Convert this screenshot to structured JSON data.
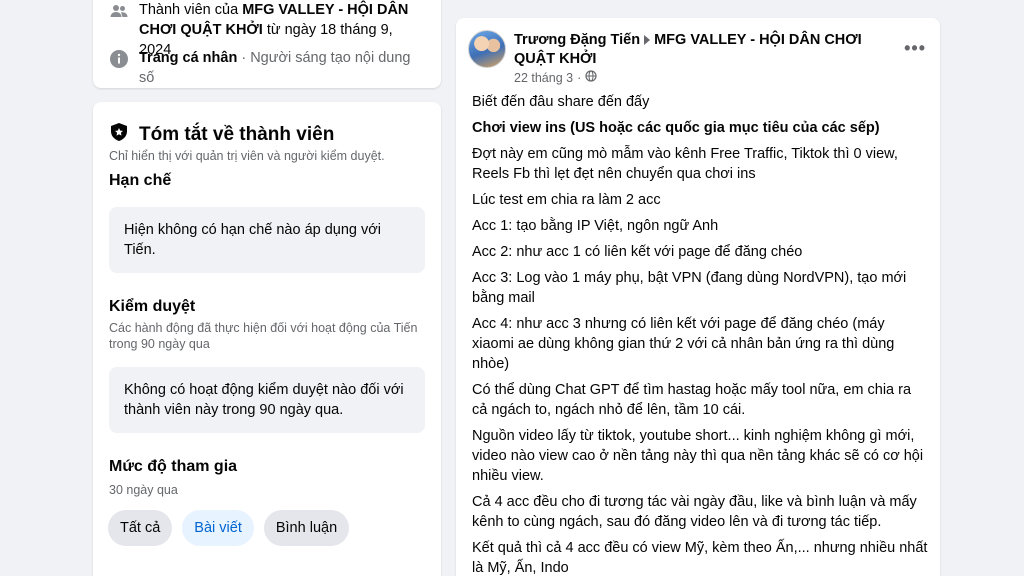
{
  "about": {
    "member_prefix": "Thành viên của ",
    "group_name": "MFG VALLEY - HỘI DÂN CHƠI QUẬT KHỞI",
    "member_suffix": " từ ngày 18 tháng 9, 2024",
    "profile_label": "Trang cá nhân",
    "profile_detail": " · Người sáng tạo nội dung số"
  },
  "summary": {
    "title": "Tóm tắt về thành viên",
    "subtitle": "Chỉ hiển thị với quản trị viên và người kiểm duyệt.",
    "restrictions_heading": "Hạn chế",
    "restrictions_text": "Hiện không có hạn chế nào áp dụng với Tiến.",
    "moderation_heading": "Kiểm duyệt",
    "moderation_desc": "Các hành động đã thực hiện đối với hoạt động của Tiến trong 90 ngày qua",
    "moderation_text": "Không có hoạt động kiểm duyệt nào đối với thành viên này trong 90 ngày qua.",
    "engagement_heading": "Mức độ tham gia",
    "engagement_period": "30 ngày qua",
    "chips": [
      {
        "label": "Tất cả",
        "active": false
      },
      {
        "label": "Bài viết",
        "active": true
      },
      {
        "label": "Bình luận",
        "active": false
      }
    ]
  },
  "post": {
    "author": "Trương Đặng Tiến",
    "group": "MFG VALLEY - HỘI DÂN CHƠI QUẬT KHỞI",
    "date": "22 tháng 3",
    "more": "•••",
    "paragraphs": [
      {
        "text": "Biết đến đâu share đến đấy",
        "bold": false
      },
      {
        "text": "Chơi view ins (US hoặc các quốc gia mục tiêu của các sếp)",
        "bold": true
      },
      {
        "text": "Đợt này em cũng mò mẫm vào kênh Free Traffic, Tiktok thì 0 view, Reels Fb thì lẹt đẹt nên chuyển qua chơi ins",
        "bold": false
      },
      {
        "text": "Lúc test em chia ra làm 2 acc",
        "bold": false
      },
      {
        "text": "Acc 1: tạo bằng IP Việt, ngôn ngữ Anh",
        "bold": false
      },
      {
        "text": "Acc 2: như acc 1 có liên kết với page để đăng chéo",
        "bold": false
      },
      {
        "text": "Acc 3: Log vào 1 máy phụ, bật VPN (đang dùng NordVPN), tạo mới bằng mail",
        "bold": false
      },
      {
        "text": "Acc 4: như acc 3 nhưng có liên kết với page để đăng chéo (máy xiaomi ae dùng không gian thứ 2 với cả nhân bản ứng ra thì dùng nhòe)",
        "bold": false
      },
      {
        "text": "Có thể dùng Chat GPT để tìm hastag hoặc mấy tool nữa, em chia ra cả ngách to, ngách nhỏ để lên, tầm 10 cái.",
        "bold": false
      },
      {
        "text": "Nguồn video lấy từ tiktok, youtube short... kinh nghiệm không gì mới, video nào view cao ở nền tảng này thì qua nền tảng khác sẽ có cơ hội nhiều view.",
        "bold": false
      },
      {
        "text": "Cả 4 acc đều cho đi tương tác vài ngày đầu, like và bình luận và mấy kênh to cùng ngách, sau đó đăng video lên và đi tương tác tiếp.",
        "bold": false
      },
      {
        "text": "Kết quả thì cả 4 acc đều có view Mỹ, kèm theo Ấn,... nhưng nhiều nhất là Mỹ, Ấn, Indo",
        "bold": false
      }
    ]
  },
  "colors": {
    "background": "#f0f2f5",
    "card": "#ffffff",
    "accent_blue": "#0064d1",
    "muted_text": "#65676b"
  }
}
